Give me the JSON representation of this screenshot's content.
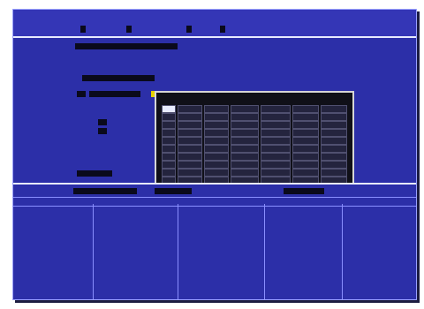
{
  "title_bar": {
    "title": "",
    "menu": [
      "",
      "",
      "",
      "",
      "",
      ""
    ]
  },
  "form": {
    "id_label": "",
    "id_value": "",
    "type_label": "",
    "type_value": "",
    "change_label": "",
    "change_values": [
      "",
      "",
      "",
      ""
    ],
    "section_label": "",
    "section_rows": [
      "",
      ""
    ],
    "footer_label": "",
    "footer_value": ""
  },
  "popup": {
    "title": "",
    "rows": [
      [
        "",
        "",
        "",
        "",
        "",
        "",
        ""
      ],
      [
        "",
        "",
        "",
        "",
        "",
        "",
        ""
      ],
      [
        "",
        "",
        "",
        "",
        "",
        "",
        ""
      ],
      [
        "",
        "",
        "",
        "",
        "",
        "",
        ""
      ],
      [
        "",
        "",
        "",
        "",
        "",
        "",
        ""
      ],
      [
        "",
        "",
        "",
        "",
        "",
        "",
        ""
      ],
      [
        "",
        "",
        "",
        "",
        "",
        "",
        ""
      ],
      [
        "",
        "",
        "",
        "",
        "",
        "",
        ""
      ],
      [
        "",
        "",
        "",
        "",
        "",
        "",
        ""
      ],
      [
        "",
        "",
        "",
        "",
        "",
        "",
        ""
      ]
    ]
  },
  "table": {
    "tabs": [
      "",
      "",
      "",
      ""
    ],
    "headers": [
      "",
      "",
      "",
      "",
      "",
      ""
    ],
    "rows": [
      [
        "",
        "",
        "",
        "",
        "",
        ""
      ],
      [
        "",
        "",
        "",
        "",
        "",
        ""
      ],
      [
        "",
        "",
        "",
        "",
        "",
        ""
      ],
      [
        "",
        "",
        "",
        "",
        "",
        ""
      ],
      [
        "",
        "",
        "",
        "",
        "",
        ""
      ],
      [
        "",
        "",
        "",
        "",
        "",
        ""
      ]
    ]
  },
  "colors": {
    "screen_bg": "#2c2fa8",
    "text": "#e8ecff",
    "highlight": "#e6d200",
    "popup_bg": "#101018"
  }
}
